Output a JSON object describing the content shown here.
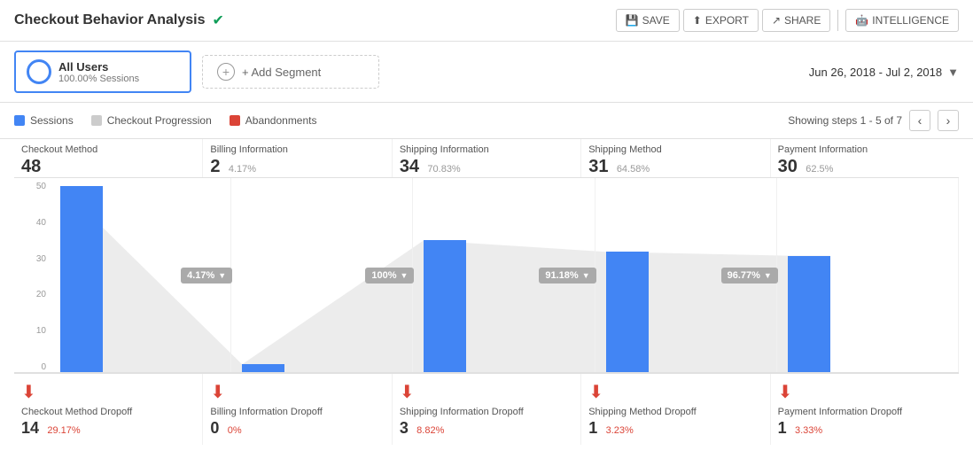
{
  "header": {
    "title": "Checkout Behavior Analysis",
    "verified": true,
    "actions": [
      {
        "id": "save",
        "label": "SAVE",
        "icon": "💾"
      },
      {
        "id": "export",
        "label": "EXPORT",
        "icon": "⬆"
      },
      {
        "id": "share",
        "label": "SHARE",
        "icon": "🔗"
      },
      {
        "id": "intelligence",
        "label": "INTELLIGENCE",
        "icon": "🤖"
      }
    ]
  },
  "segment": {
    "name": "All Users",
    "sub": "100.00% Sessions",
    "add_label": "+ Add Segment"
  },
  "date_range": "Jun 26, 2018 - Jul 2, 2018",
  "legend": {
    "sessions": "Sessions",
    "progression": "Checkout Progression",
    "abandonments": "Abandonments"
  },
  "steps_info": "Showing steps 1 - 5 of 7",
  "columns": [
    {
      "id": "checkout-method",
      "title": "Checkout Method",
      "value": "48",
      "pct": "",
      "bar_height_pct": 95,
      "prog_label": "4.17%",
      "funnel_to": 4
    },
    {
      "id": "billing-information",
      "title": "Billing Information",
      "value": "2",
      "pct": "4.17%",
      "bar_height_pct": 4,
      "prog_label": "100%",
      "funnel_to": 70
    },
    {
      "id": "shipping-information",
      "title": "Shipping Information",
      "value": "34",
      "pct": "70.83%",
      "bar_height_pct": 65,
      "prog_label": "91.18%",
      "funnel_to": 64
    },
    {
      "id": "shipping-method",
      "title": "Shipping Method",
      "value": "31",
      "pct": "64.58%",
      "bar_height_pct": 60,
      "prog_label": "96.77%",
      "funnel_to": 59
    },
    {
      "id": "payment-information",
      "title": "Payment Information",
      "value": "30",
      "pct": "62.5%",
      "bar_height_pct": 58,
      "prog_label": "",
      "funnel_to": 0
    }
  ],
  "dropoffs": [
    {
      "id": "checkout-method-dropoff",
      "title": "Checkout Method Dropoff",
      "value": "14",
      "pct": "29.17%"
    },
    {
      "id": "billing-information-dropoff",
      "title": "Billing Information Dropoff",
      "value": "0",
      "pct": "0%"
    },
    {
      "id": "shipping-information-dropoff",
      "title": "Shipping Information Dropoff",
      "value": "3",
      "pct": "8.82%"
    },
    {
      "id": "shipping-method-dropoff",
      "title": "Shipping Method Dropoff",
      "value": "1",
      "pct": "3.23%"
    },
    {
      "id": "payment-information-dropoff",
      "title": "Payment Information Dropoff",
      "value": "1",
      "pct": "3.33%"
    }
  ],
  "chart": {
    "y_labels": [
      "50",
      "40",
      "30",
      "20",
      "10",
      "0"
    ],
    "max_value": 50,
    "bar_values": [
      48,
      2,
      34,
      31,
      30
    ]
  }
}
